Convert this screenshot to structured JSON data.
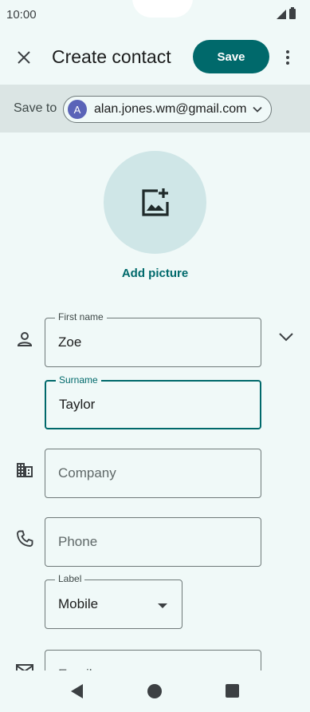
{
  "status_bar": {
    "time": "10:00"
  },
  "app_bar": {
    "title": "Create contact",
    "save_label": "Save"
  },
  "save_to": {
    "label": "Save to",
    "avatar_letter": "A",
    "account_email": "alan.jones.wm@gmail.com"
  },
  "picture": {
    "add_label": "Add picture"
  },
  "fields": {
    "first_name": {
      "label": "First name",
      "value": "Zoe"
    },
    "surname": {
      "label": "Surname",
      "value": "Taylor"
    },
    "company": {
      "placeholder": "Company"
    },
    "phone": {
      "placeholder": "Phone"
    },
    "phone_label": {
      "label": "Label",
      "value": "Mobile"
    },
    "email": {
      "placeholder": "Email"
    }
  },
  "colors": {
    "accent": "#00696b",
    "background": "#f0f9f8",
    "saveto_background": "#dbe5e4",
    "picture_circle": "#cfe6e7",
    "avatar": "#5a63b8"
  },
  "icons": [
    "close-icon",
    "more-vert-icon",
    "chevron-down-icon",
    "add-photo-icon",
    "person-icon",
    "business-icon",
    "phone-icon",
    "email-icon",
    "nav-back-icon",
    "nav-home-icon",
    "nav-recents-icon"
  ]
}
